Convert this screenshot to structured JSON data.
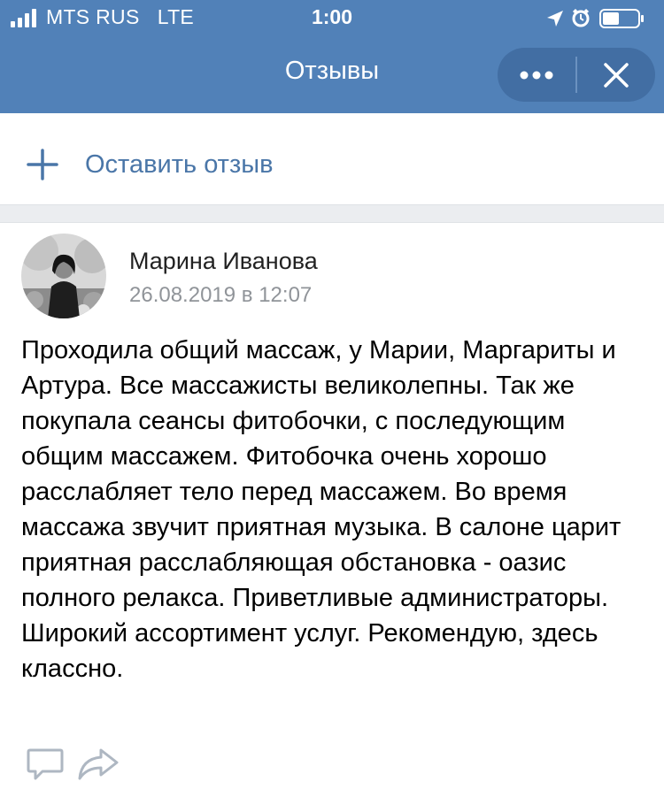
{
  "status_bar": {
    "carrier": "MTS RUS",
    "network": "LTE",
    "time": "1:00",
    "icons": [
      "signal-icon",
      "location-arrow-icon",
      "alarm-icon",
      "battery-icon"
    ]
  },
  "header": {
    "title": "Отзывы",
    "more_icon": "more-dots-icon",
    "close_icon": "close-icon"
  },
  "add_review": {
    "icon": "plus-icon",
    "label": "Оставить отзыв"
  },
  "review": {
    "author": "Марина Иванова",
    "date": "26.08.2019 в 12:07",
    "text": "Проходила общий массаж, у Марии, Маргариты и Артура. Все массажисты великолепны. Так же покупала сеансы фитобочки, с последующим общим массажем. Фитобочка очень хорошо расслабляет тело перед массажем. Во время массажа звучит приятная музыка. В салоне царит приятная расслабляющая обстановка - оазис полного релакса. Приветливые администраторы. Широкий ассортимент услуг. Рекомендую, здесь классно.",
    "actions": [
      "comment-icon",
      "share-icon"
    ]
  },
  "colors": {
    "header_bg": "#5181b8",
    "pill_bg": "#426ea3",
    "accent": "#4a76a8",
    "separator": "#ebedf0",
    "secondary_text": "#909499"
  }
}
